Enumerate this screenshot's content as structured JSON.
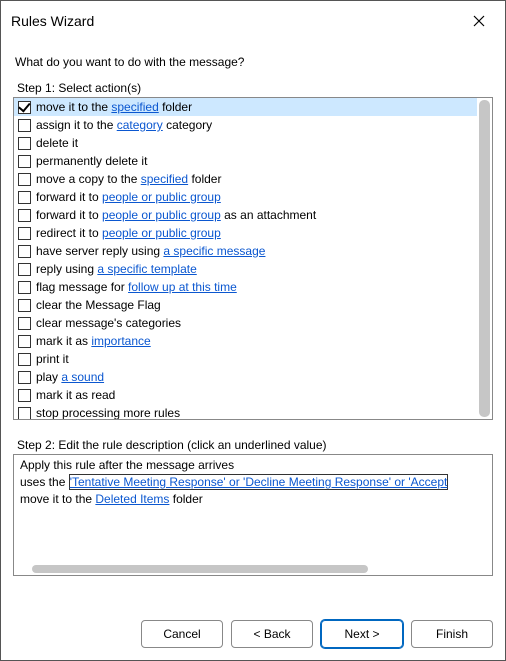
{
  "window": {
    "title": "Rules Wizard"
  },
  "question": "What do you want to do with the message?",
  "step1_label": "Step 1: Select action(s)",
  "actions": [
    {
      "checked": true,
      "pre": "move it to the ",
      "link": "specified",
      "post": " folder",
      "selected": true
    },
    {
      "checked": false,
      "pre": "assign it to the ",
      "link": "category",
      "post": " category"
    },
    {
      "checked": false,
      "pre": "delete it",
      "link": "",
      "post": ""
    },
    {
      "checked": false,
      "pre": "permanently delete it",
      "link": "",
      "post": ""
    },
    {
      "checked": false,
      "pre": "move a copy to the ",
      "link": "specified",
      "post": " folder"
    },
    {
      "checked": false,
      "pre": "forward it to ",
      "link": "people or public group",
      "post": ""
    },
    {
      "checked": false,
      "pre": "forward it to ",
      "link": "people or public group",
      "post": " as an attachment"
    },
    {
      "checked": false,
      "pre": "redirect it to ",
      "link": "people or public group",
      "post": ""
    },
    {
      "checked": false,
      "pre": "have server reply using ",
      "link": "a specific message",
      "post": ""
    },
    {
      "checked": false,
      "pre": "reply using ",
      "link": "a specific template",
      "post": ""
    },
    {
      "checked": false,
      "pre": "flag message for ",
      "link": "follow up at this time",
      "post": ""
    },
    {
      "checked": false,
      "pre": "clear the Message Flag",
      "link": "",
      "post": ""
    },
    {
      "checked": false,
      "pre": "clear message's categories",
      "link": "",
      "post": ""
    },
    {
      "checked": false,
      "pre": "mark it as ",
      "link": "importance",
      "post": ""
    },
    {
      "checked": false,
      "pre": "print it",
      "link": "",
      "post": ""
    },
    {
      "checked": false,
      "pre": "play ",
      "link": "a sound",
      "post": ""
    },
    {
      "checked": false,
      "pre": "mark it as read",
      "link": "",
      "post": ""
    },
    {
      "checked": false,
      "pre": "stop processing more rules",
      "link": "",
      "post": ""
    }
  ],
  "step2_label": "Step 2: Edit the rule description (click an underlined value)",
  "desc": {
    "line1": "Apply this rule after the message arrives",
    "line2_pre": "uses the ",
    "line2_link": "'Tentative Meeting Response' or 'Decline Meeting Response' or 'Accept",
    "line3_pre": "move it to the ",
    "line3_link": "Deleted Items",
    "line3_post": " folder"
  },
  "buttons": {
    "cancel": "Cancel",
    "back": "< Back",
    "next": "Next >",
    "finish": "Finish"
  }
}
